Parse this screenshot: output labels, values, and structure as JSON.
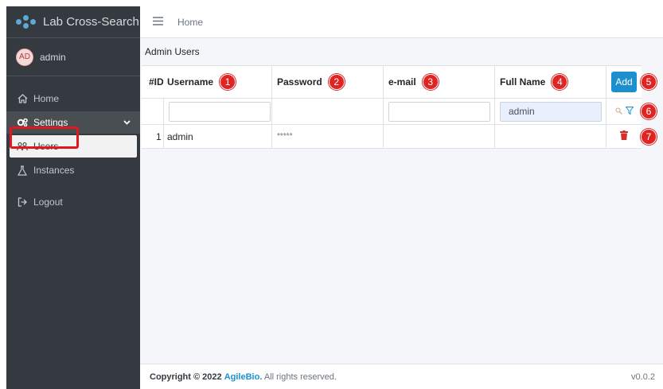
{
  "sidebar": {
    "brand": "Lab Cross-Search",
    "user_initials": "AD",
    "user_name": "admin",
    "items": [
      {
        "label": "Home",
        "icon": "home-icon"
      },
      {
        "label": "Settings",
        "icon": "gears-icon"
      },
      {
        "label": "Users",
        "icon": "users-icon"
      },
      {
        "label": "Instances",
        "icon": "flask-icon"
      },
      {
        "label": "Logout",
        "icon": "logout-icon"
      }
    ]
  },
  "header": {
    "breadcrumb": "Home"
  },
  "main": {
    "title": "Admin Users",
    "columns": [
      "#ID",
      "Username",
      "Password",
      "e-mail",
      "Full Name"
    ],
    "add_label": "Add",
    "filters": {
      "username": "",
      "email": "",
      "full_name": "admin"
    },
    "rows": [
      {
        "id": "1",
        "username": "admin",
        "password": "*****",
        "email": "",
        "full_name": ""
      }
    ],
    "badges": [
      "1",
      "2",
      "3",
      "4",
      "5",
      "6",
      "7"
    ]
  },
  "footer": {
    "copyright_prefix": "Copyright © 2022",
    "company": "AgileBio.",
    "rights": "All rights reserved.",
    "version": "v0.0.2"
  },
  "colors": {
    "accent": "#1d8fcf",
    "badge": "#e02424",
    "sidebar": "#343a40"
  }
}
